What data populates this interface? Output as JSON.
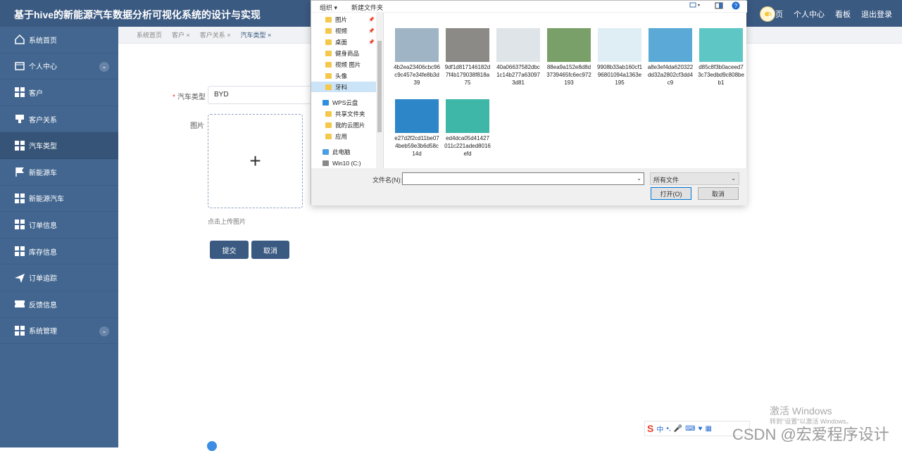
{
  "app": {
    "title": "基于hive的新能源汽车数据分析可视化系统的设计与实现",
    "top_nav": [
      "首页",
      "个人中心",
      "看板",
      "退出登录"
    ]
  },
  "sidebar": {
    "items": [
      {
        "label": "系统首页",
        "icon": "home-icon"
      },
      {
        "label": "个人中心",
        "icon": "id-card-icon",
        "expandable": true
      },
      {
        "label": "客户",
        "icon": "grid-icon"
      },
      {
        "label": "客户关系",
        "icon": "badge-icon"
      },
      {
        "label": "汽车类型",
        "icon": "grid-icon",
        "active": true
      },
      {
        "label": "新能源车",
        "icon": "flag-icon"
      },
      {
        "label": "新能源汽车",
        "icon": "grid-icon"
      },
      {
        "label": "订单信息",
        "icon": "grid-icon"
      },
      {
        "label": "库存信息",
        "icon": "grid-icon"
      },
      {
        "label": "订单追踪",
        "icon": "send-icon"
      },
      {
        "label": "反馈信息",
        "icon": "ticket-icon"
      },
      {
        "label": "系统管理",
        "icon": "grid-icon",
        "expandable": true
      }
    ]
  },
  "breadcrumbs": [
    "系统首页",
    "客户 ×",
    "客户关系 ×",
    "汽车类型 ×"
  ],
  "form": {
    "car_type_label": "汽车类型",
    "car_type_value": "BYD",
    "image_label": "图片",
    "upload_plus": "+",
    "upload_hint": "点击上传图片",
    "submit": "提交",
    "cancel": "取消"
  },
  "dialog": {
    "toolbar": {
      "organize": "组织 ▾",
      "new_folder": "新建文件夹"
    },
    "nav": [
      {
        "label": "图片",
        "pinned": true
      },
      {
        "label": "视频",
        "pinned": true
      },
      {
        "label": "桌面",
        "pinned": true
      },
      {
        "label": "健身商品"
      },
      {
        "label": "视频 图片"
      },
      {
        "label": "头像"
      },
      {
        "label": "牙科",
        "selected": true
      },
      {
        "label": "WPS云盘"
      },
      {
        "label": "共享文件夹"
      },
      {
        "label": "我的云图片"
      },
      {
        "label": "应用"
      },
      {
        "label": "此电脑"
      },
      {
        "label": "Win10 (C:)"
      }
    ],
    "files": [
      {
        "name": "4b2ea23406cbc96c9c457e34fe8b3d39",
        "color": "#9fb4c4"
      },
      {
        "name": "9df1d817146182d7f4b179038f818a75",
        "color": "#8c8a86"
      },
      {
        "name": "40a06637582dbc1c14b277a630973d81",
        "color": "#dfe4e8"
      },
      {
        "name": "88ea9a152e8d8d3739465fc6ec972193",
        "color": "#7aa06a"
      },
      {
        "name": "9908b33ab160cf196801094a1363e195",
        "color": "#dfeef5"
      },
      {
        "name": "a8e3ef4da620322dd32a2802cf3dd4c9",
        "color": "#5aa9d6"
      },
      {
        "name": "d85c8f3b0aceed73c73edbd9c808beb1",
        "color": "#5fc6c6"
      },
      {
        "name": "e27d2f2cd11be074beb59e3b6d58c14d",
        "color": "#2c86c8"
      },
      {
        "name": "ed4dca05d41427011c221aded8016efd",
        "color": "#3fb7a8"
      }
    ],
    "filename_label": "文件名(N):",
    "filename_value": "",
    "filetype": "所有文件",
    "open": "打开(O)",
    "cancel": "取消"
  },
  "windows_watermark": {
    "line1": "激活 Windows",
    "line2": "转到\"设置\"以激活 Windows。"
  },
  "csdn_watermark": "CSDN @宏爱程序设计",
  "ime": {
    "label": "中"
  }
}
